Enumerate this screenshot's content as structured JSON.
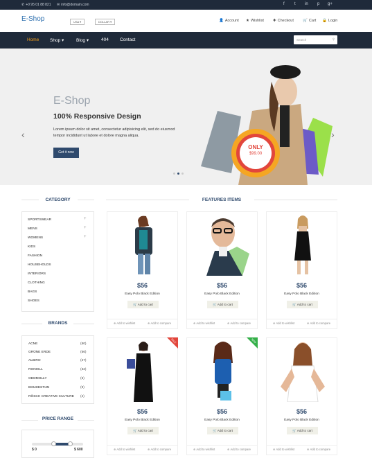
{
  "topbar": {
    "phone": "+0 95 01 88 821",
    "email": "info@domain.com",
    "social": [
      "f",
      "t",
      "in",
      "p",
      "g+"
    ]
  },
  "header": {
    "logo": "E-Shop",
    "currency": "USA",
    "currency2": "DOLLAR",
    "links": [
      {
        "label": "Account",
        "icon": "user-icon"
      },
      {
        "label": "Wishlist",
        "icon": "star-icon"
      },
      {
        "label": "Checkout",
        "icon": "crosshair-icon"
      },
      {
        "label": "Cart",
        "icon": "cart-icon"
      },
      {
        "label": "Login",
        "icon": "lock-icon"
      }
    ]
  },
  "nav": {
    "items": [
      "Home",
      "Shop",
      "Blog",
      "404",
      "Contact"
    ],
    "search_placeholder": "Search"
  },
  "hero": {
    "title": "E-Shop",
    "subtitle": "100% Responsive Design",
    "text": "Lorem ipsum dolor sit amet, consectetur adipisicing elit, sed do eiusmod tempor incididunt ut labore et dolore magna aliqua.",
    "button": "Get it now",
    "badge_top": "ONLY",
    "badge_price": "$99.00"
  },
  "sidebar": {
    "category_title": "CATEGORY",
    "categories": [
      "Sportswear",
      "Mens",
      "Womens",
      "Kids",
      "Fashion",
      "Households",
      "Interiors",
      "Clothing",
      "Bags",
      "Shoes"
    ],
    "brands_title": "BRANDS",
    "brands": [
      {
        "name": "Acne",
        "count": "(50)"
      },
      {
        "name": "Grüne Erde",
        "count": "(56)"
      },
      {
        "name": "Albiro",
        "count": "(27)"
      },
      {
        "name": "Ronhill",
        "count": "(32)"
      },
      {
        "name": "Oddmolly",
        "count": "(5)"
      },
      {
        "name": "Boudestijn",
        "count": "(9)"
      },
      {
        "name": "Rösch creative culture",
        "count": "(4)"
      }
    ],
    "price_title": "PRICE RANGE",
    "price_min": "$ 0",
    "price_max": "$ 600"
  },
  "features": {
    "title": "FEATURES ITEMS",
    "products": [
      {
        "price": "$56",
        "name": "Easy Polo Black Edition",
        "cart": "Add to cart",
        "wish": "Add to wishlist",
        "compare": "Add to compare",
        "badge": ""
      },
      {
        "price": "$56",
        "name": "Easy Polo Black Edition",
        "cart": "Add to cart",
        "wish": "Add to wishlist",
        "compare": "Add to compare",
        "badge": ""
      },
      {
        "price": "$56",
        "name": "Easy Polo Black Edition",
        "cart": "Add to cart",
        "wish": "Add to wishlist",
        "compare": "Add to compare",
        "badge": ""
      },
      {
        "price": "$56",
        "name": "Easy Polo Black Edition",
        "cart": "Add to cart",
        "wish": "Add to wishlist",
        "compare": "Add to compare",
        "badge": "SALE"
      },
      {
        "price": "$56",
        "name": "Easy Polo Black Edition",
        "cart": "Add to cart",
        "wish": "Add to wishlist",
        "compare": "Add to compare",
        "badge": "NEW"
      },
      {
        "price": "$56",
        "name": "Easy Polo Black Edition",
        "cart": "Add to cart",
        "wish": "Add to wishlist",
        "compare": "Add to compare",
        "badge": ""
      }
    ]
  },
  "colors": {
    "navy": "#1f2a3a",
    "accent": "#f6a01a",
    "sale": "#e2463c",
    "new": "#35b04a"
  }
}
